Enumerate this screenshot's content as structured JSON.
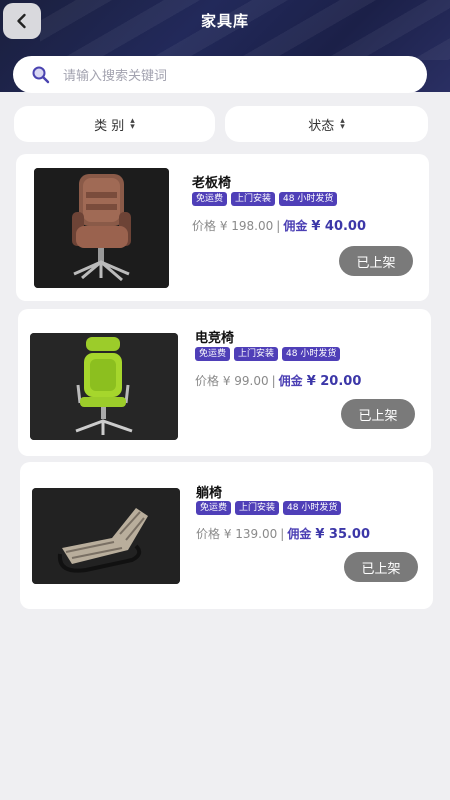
{
  "header": {
    "title": "家具库",
    "back_icon": "chevron-left-icon"
  },
  "search": {
    "placeholder": "请输入搜索关键词",
    "icon": "search-icon"
  },
  "filters": [
    {
      "label": "类 别",
      "icon": "sort-arrows-icon"
    },
    {
      "label": "状态",
      "icon": "sort-arrows-icon"
    }
  ],
  "products": [
    {
      "name": "老板椅",
      "tags": [
        "免运费",
        "上门安装",
        "48 小时发货"
      ],
      "price": "价格 ¥ 198.00",
      "separator": "|",
      "commission_label": "佣金",
      "commission": "¥ 40.00",
      "status": "已上架"
    },
    {
      "name": "电竞椅",
      "tags": [
        "免运费",
        "上门安装",
        "48 小时发货"
      ],
      "price": "价格 ¥ 99.00",
      "separator": "|",
      "commission_label": "佣金",
      "commission": "¥ 20.00",
      "status": "已上架"
    },
    {
      "name": "躺椅",
      "tags": [
        "免运费",
        "上门安装",
        "48 小时发货"
      ],
      "price": "价格 ¥ 139.00",
      "separator": "|",
      "commission_label": "佣金",
      "commission": "¥ 35.00",
      "status": "已上架"
    }
  ],
  "colors": {
    "tag_bg": "#4f3fb8",
    "commission": "#3c37a8",
    "header_bg": "#1e2450",
    "status_button": "#7a7a7a"
  }
}
